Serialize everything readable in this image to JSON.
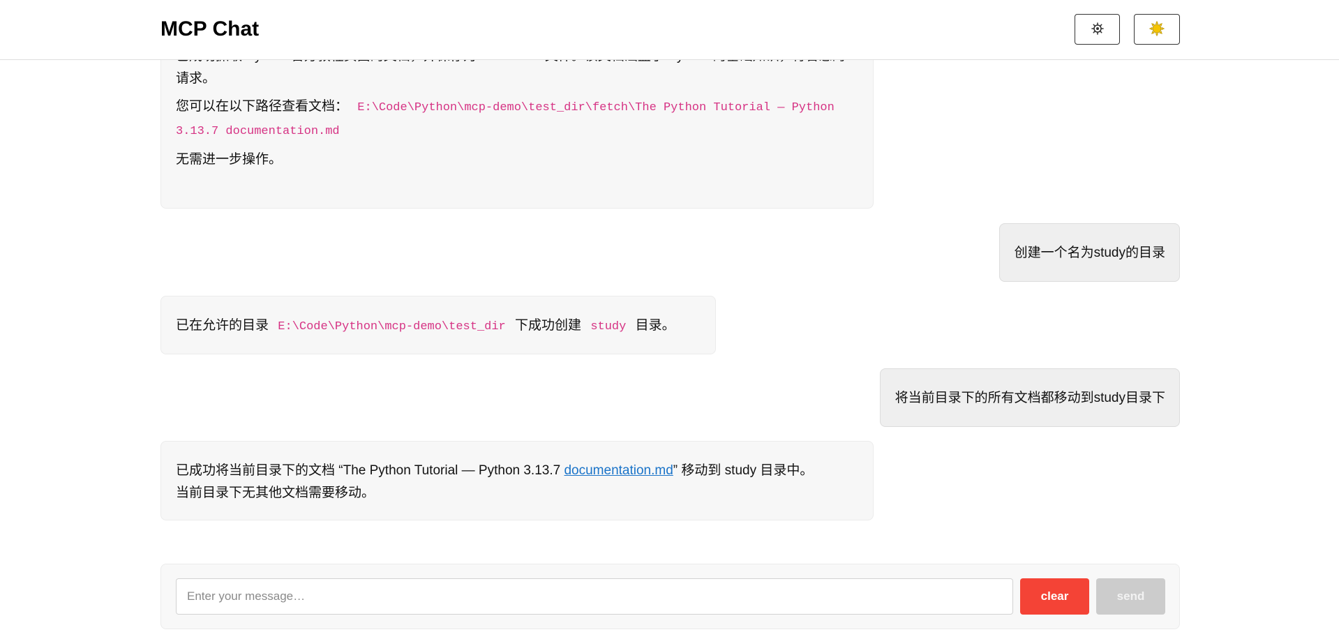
{
  "header": {
    "title": "MCP Chat",
    "settings_icon": "gear-icon",
    "theme_icon": "sun-icon"
  },
  "messages": [
    {
      "role": "assistant",
      "line1": "已成功抓取 Python 官方教程页面的文档，并保存为 Markdown 文件。该文档涵盖了 Python 的基础知识，符合您的请求。",
      "path_prefix": "您可以在以下路径查看文档：",
      "path": "E:\\Code\\Python\\mcp-demo\\test_dir\\fetch\\The Python Tutorial — Python 3.13.7 documentation.md",
      "closing": "无需进一步操作。"
    },
    {
      "role": "user",
      "text": "创建一个名为study的目录"
    },
    {
      "role": "assistant",
      "part1": "已在允许的目录",
      "code1": "E:\\Code\\Python\\mcp-demo\\test_dir",
      "part2": "下成功创建",
      "code2": "study",
      "part3": "目录。"
    },
    {
      "role": "user",
      "text": "将当前目录下的所有文档都移动到study目录下"
    },
    {
      "role": "assistant",
      "part1": "已成功将当前目录下的文档 “The Python Tutorial — Python 3.13.7 ",
      "link": "documentation.md",
      "part2": "” 移动到 study 目录中。",
      "line2": "当前目录下无其他文档需要移动。"
    }
  ],
  "composer": {
    "placeholder": "Enter your message…",
    "value": "",
    "clear_label": "clear",
    "send_label": "send",
    "clear_color": "#f44336",
    "send_color_disabled": "#cccccc"
  },
  "colors": {
    "code_text": "#d63384",
    "link": "#1a73c8",
    "assistant_bubble": "#f7f7f7",
    "user_bubble": "#efefef"
  }
}
